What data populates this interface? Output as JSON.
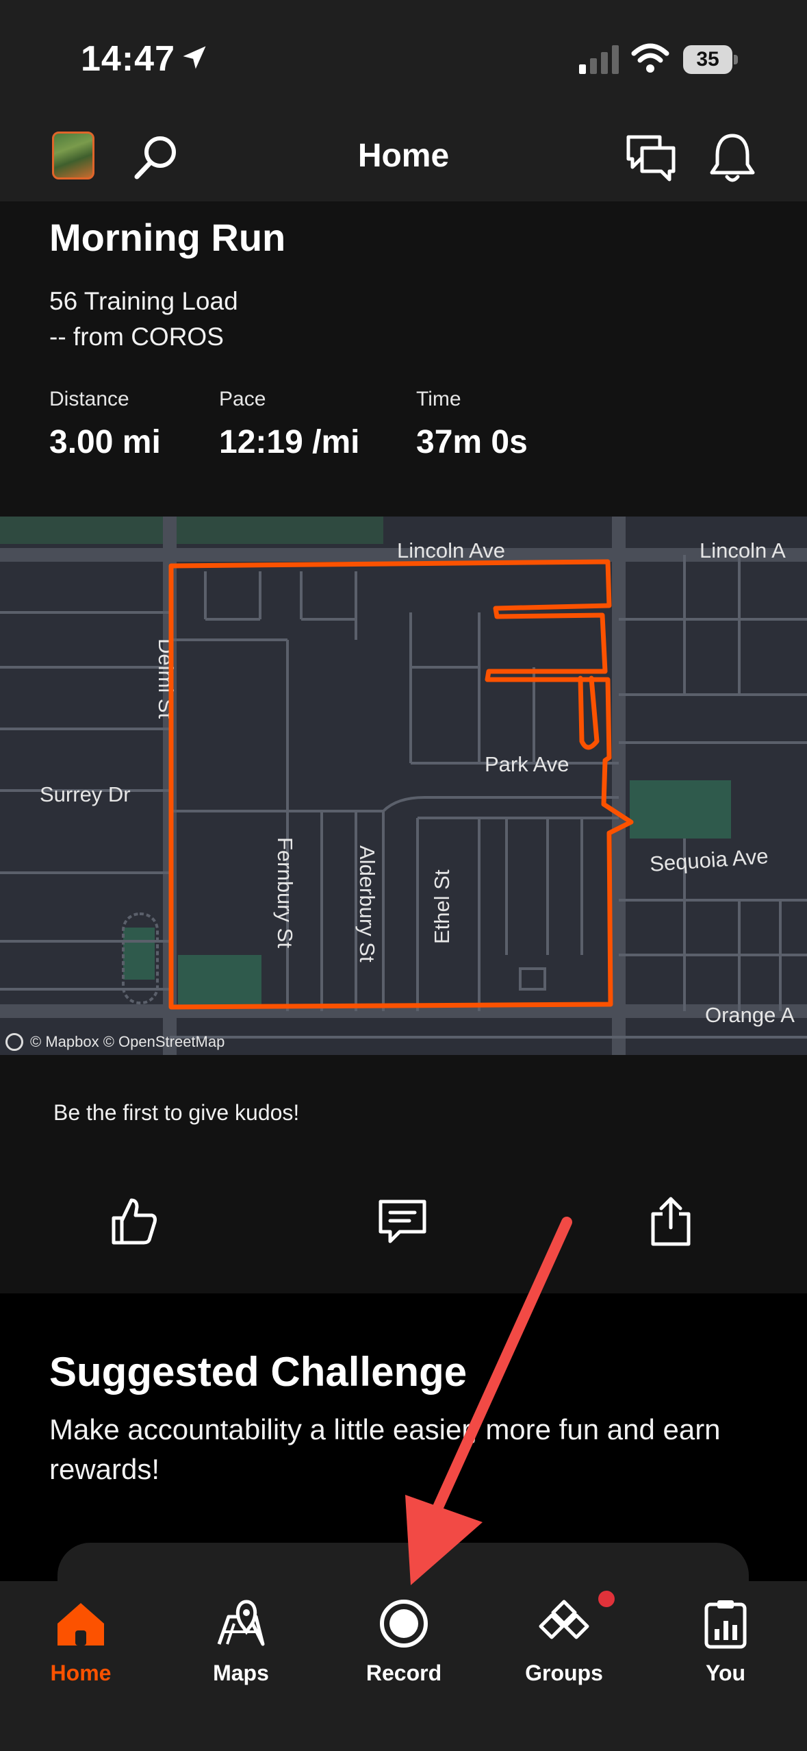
{
  "status_bar": {
    "time": "14:47",
    "battery": "35"
  },
  "nav": {
    "title": "Home"
  },
  "activity": {
    "title": "Morning Run",
    "training_load": "56 Training Load",
    "source": "-- from COROS",
    "stats": [
      {
        "label": "Distance",
        "value": "3.00 mi"
      },
      {
        "label": "Pace",
        "value": "12:19 /mi"
      },
      {
        "label": "Time",
        "value": "37m 0s"
      }
    ]
  },
  "map": {
    "streets": {
      "lincoln1": "Lincoln Ave",
      "lincoln2": "Lincoln A",
      "delmi": "Delmi St",
      "surrey": "Surrey Dr",
      "park": "Park Ave",
      "sequoia": "Sequoia Ave",
      "fernbury": "Fernbury St",
      "alderbury": "Alderbury St",
      "ethel": "Ethel St",
      "orange": "Orange A"
    },
    "attribution": "© Mapbox © OpenStreetMap",
    "route_color": "#fc5200"
  },
  "kudos": {
    "text": "Be the first to give kudos!"
  },
  "challenge": {
    "title": "Suggested Challenge",
    "description": "Make accountability a little easier, more fun and earn rewards!"
  },
  "tabs": [
    {
      "label": "Home",
      "icon": "home-icon"
    },
    {
      "label": "Maps",
      "icon": "maps-icon"
    },
    {
      "label": "Record",
      "icon": "record-icon"
    },
    {
      "label": "Groups",
      "icon": "groups-icon"
    },
    {
      "label": "You",
      "icon": "you-icon"
    }
  ],
  "colors": {
    "accent": "#fc5200",
    "annotation_arrow": "#f24a45",
    "badge": "#e0323a"
  }
}
